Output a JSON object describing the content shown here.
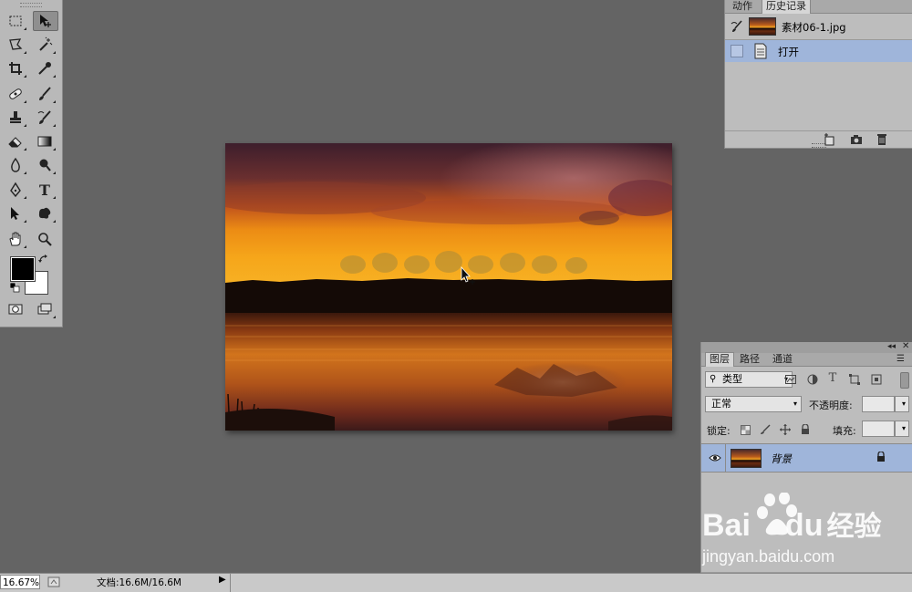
{
  "history_panel": {
    "tabs": [
      {
        "label": "动作",
        "active": false
      },
      {
        "label": "历史记录",
        "active": true
      }
    ],
    "snapshot": {
      "name": "素材06-1.jpg"
    },
    "steps": [
      {
        "label": "打开",
        "selected": true
      }
    ],
    "footer_icons": [
      "new-document-from-state-icon",
      "camera-icon",
      "trash-icon"
    ]
  },
  "layers_panel": {
    "tabs": [
      {
        "label": "图层",
        "active": true
      },
      {
        "label": "路径",
        "active": false
      },
      {
        "label": "通道",
        "active": false
      }
    ],
    "filter": {
      "label": "类型"
    },
    "blend_mode": "正常",
    "opacity_label": "不透明度:",
    "opacity_value": "",
    "lock_label": "锁定:",
    "fill_label": "填充:",
    "fill_value": "",
    "layers": [
      {
        "name": "背景",
        "visible": true,
        "locked": true,
        "selected": true
      }
    ],
    "footer_icons": [
      "link-icon",
      "fx-icon",
      "mask-icon",
      "adjustment-icon",
      "group-icon",
      "new-layer-icon",
      "trash-icon"
    ]
  },
  "status_bar": {
    "zoom": "16.67%",
    "doc_info": "文档:16.6M/16.6M"
  },
  "watermark": {
    "brand": "Bai",
    "brand_tail": "du",
    "site_name": "经验",
    "url": "jingyan.baidu.com"
  },
  "colors": {
    "panel_bg": "#bdbdbd",
    "workspace_bg": "#646464",
    "selection_blue": "#9fb5da"
  }
}
